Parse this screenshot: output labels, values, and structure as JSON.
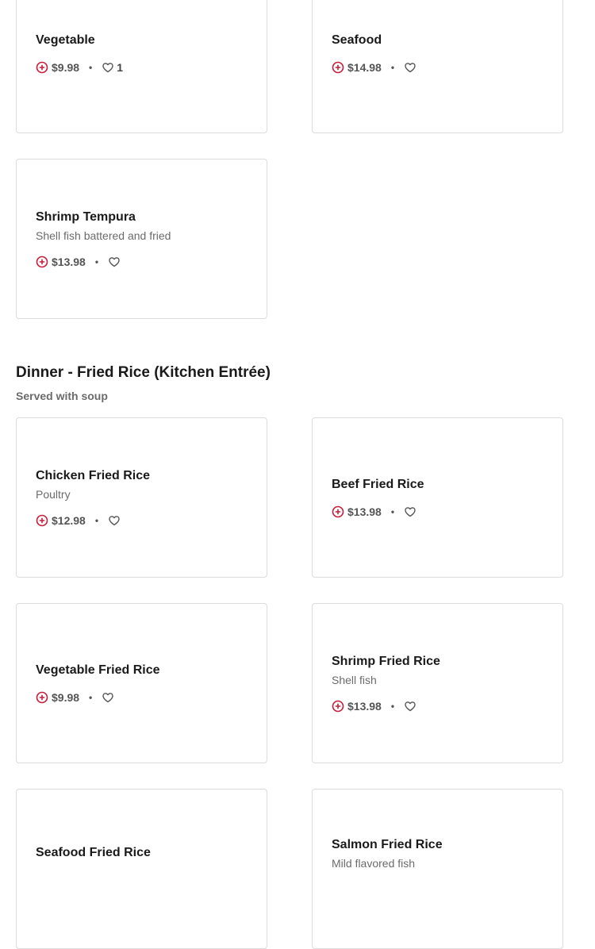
{
  "colors": {
    "accent": "#c41e3a",
    "text": "#1a1a1a",
    "muted": "#6b6b6b",
    "border": "#dcdcdc"
  },
  "icons": {
    "add": "plus-circle-icon",
    "favorite": "heart-icon"
  },
  "separator": "•",
  "previous_section": {
    "items": [
      {
        "name": "Vegetable",
        "price": "$9.98",
        "likes": "1"
      },
      {
        "name": "Seafood",
        "price": "$14.98"
      },
      {
        "name": "Shrimp Tempura",
        "description": "Shell fish battered and fried",
        "price": "$13.98"
      }
    ]
  },
  "fried_rice_section": {
    "title": "Dinner - Fried Rice (Kitchen Entrée)",
    "subtitle": "Served with soup",
    "items": [
      {
        "name": "Chicken Fried Rice",
        "description": "Poultry",
        "price": "$12.98"
      },
      {
        "name": "Beef Fried Rice",
        "price": "$13.98"
      },
      {
        "name": "Vegetable Fried Rice",
        "price": "$9.98"
      },
      {
        "name": "Shrimp Fried Rice",
        "description": "Shell fish",
        "price": "$13.98"
      },
      {
        "name": "Seafood Fried Rice"
      },
      {
        "name": "Salmon Fried Rice",
        "description": "Mild flavored fish"
      }
    ]
  }
}
